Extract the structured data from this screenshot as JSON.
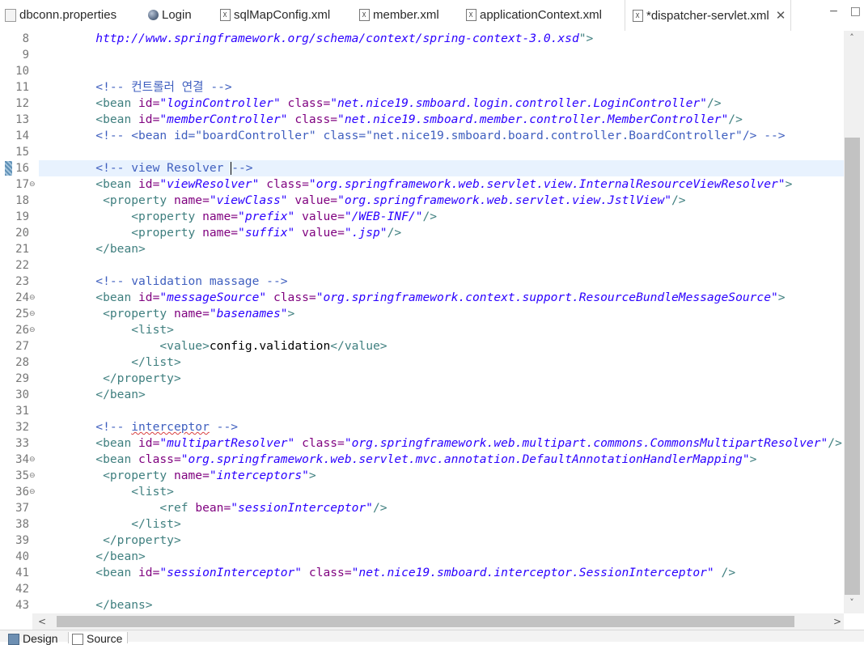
{
  "tabs": [
    {
      "label": "dbconn.properties",
      "icon": "properties-file-icon",
      "active": false,
      "closable": false
    },
    {
      "label": "Login",
      "icon": "globe-icon",
      "active": false,
      "closable": false
    },
    {
      "label": "sqlMapConfig.xml",
      "icon": "xml-file-icon",
      "active": false,
      "closable": false
    },
    {
      "label": "member.xml",
      "icon": "xml-file-icon",
      "active": false,
      "closable": false
    },
    {
      "label": "applicationContext.xml",
      "icon": "xml-file-icon",
      "active": false,
      "closable": false
    },
    {
      "label": "*dispatcher-servlet.xml",
      "icon": "xml-file-icon",
      "active": true,
      "closable": true
    }
  ],
  "tab_close_glyph": "✕",
  "view_controls": {
    "minimize": "−",
    "maximize": "□"
  },
  "editor": {
    "current_line": 16,
    "lines": [
      {
        "n": "8",
        "fold": "",
        "segs": [
          [
            "",
            "        "
          ],
          [
            "v",
            "http://www.springframework.org/schema/context/spring-context-3.0.xsd"
          ],
          [
            "t",
            "\">"
          ]
        ]
      },
      {
        "n": "9",
        "fold": "",
        "segs": []
      },
      {
        "n": "10",
        "fold": "",
        "segs": []
      },
      {
        "n": "11",
        "fold": "",
        "segs": [
          [
            "",
            "        "
          ],
          [
            "c",
            "<!-- 컨트롤러 연결 -->"
          ]
        ]
      },
      {
        "n": "12",
        "fold": "",
        "segs": [
          [
            "",
            "        "
          ],
          [
            "t",
            "<bean "
          ],
          [
            "a",
            "id="
          ],
          [
            "v",
            "\"loginController\""
          ],
          [
            "",
            " "
          ],
          [
            "a",
            "class="
          ],
          [
            "v",
            "\"net.nice19.smboard.login.controller.LoginController\""
          ],
          [
            "t",
            "/>"
          ]
        ]
      },
      {
        "n": "13",
        "fold": "",
        "segs": [
          [
            "",
            "        "
          ],
          [
            "t",
            "<bean "
          ],
          [
            "a",
            "id="
          ],
          [
            "v",
            "\"memberController\""
          ],
          [
            "",
            " "
          ],
          [
            "a",
            "class="
          ],
          [
            "v",
            "\"net.nice19.smboard.member.controller.MemberController\""
          ],
          [
            "t",
            "/>"
          ]
        ]
      },
      {
        "n": "14",
        "fold": "",
        "segs": [
          [
            "",
            "        "
          ],
          [
            "c",
            "<!-- <bean id=\"boardController\" class=\"net.nice19.smboard.board.controller.BoardController\"/> -->"
          ]
        ]
      },
      {
        "n": "15",
        "fold": "",
        "segs": []
      },
      {
        "n": "16",
        "fold": "",
        "segs": [
          [
            "",
            "        "
          ],
          [
            "c",
            "<!-- view Resolver "
          ],
          [
            "caret",
            ""
          ],
          [
            "c",
            "-->"
          ]
        ]
      },
      {
        "n": "17",
        "fold": "⊖",
        "segs": [
          [
            "",
            "        "
          ],
          [
            "t",
            "<bean "
          ],
          [
            "a",
            "id="
          ],
          [
            "v",
            "\"viewResolver\""
          ],
          [
            "",
            " "
          ],
          [
            "a",
            "class="
          ],
          [
            "v",
            "\"org.springframework.web.servlet.view.InternalResourceViewResolver\""
          ],
          [
            "t",
            ">"
          ]
        ]
      },
      {
        "n": "18",
        "fold": "",
        "segs": [
          [
            "",
            "         "
          ],
          [
            "t",
            "<property "
          ],
          [
            "a",
            "name="
          ],
          [
            "v",
            "\"viewClass\""
          ],
          [
            "",
            " "
          ],
          [
            "a",
            "value="
          ],
          [
            "v",
            "\"org.springframework.web.servlet.view.JstlView\""
          ],
          [
            "t",
            "/>"
          ]
        ]
      },
      {
        "n": "19",
        "fold": "",
        "segs": [
          [
            "",
            "             "
          ],
          [
            "t",
            "<property "
          ],
          [
            "a",
            "name="
          ],
          [
            "v",
            "\"prefix\""
          ],
          [
            "",
            " "
          ],
          [
            "a",
            "value="
          ],
          [
            "v",
            "\"/WEB-INF/\""
          ],
          [
            "t",
            "/>"
          ]
        ]
      },
      {
        "n": "20",
        "fold": "",
        "segs": [
          [
            "",
            "             "
          ],
          [
            "t",
            "<property "
          ],
          [
            "a",
            "name="
          ],
          [
            "v",
            "\"suffix\""
          ],
          [
            "",
            " "
          ],
          [
            "a",
            "value="
          ],
          [
            "v",
            "\".jsp\""
          ],
          [
            "t",
            "/>"
          ]
        ]
      },
      {
        "n": "21",
        "fold": "",
        "segs": [
          [
            "",
            "        "
          ],
          [
            "t",
            "</bean>"
          ]
        ]
      },
      {
        "n": "22",
        "fold": "",
        "segs": []
      },
      {
        "n": "23",
        "fold": "",
        "segs": [
          [
            "",
            "        "
          ],
          [
            "c",
            "<!-- validation massage -->"
          ]
        ]
      },
      {
        "n": "24",
        "fold": "⊖",
        "segs": [
          [
            "",
            "        "
          ],
          [
            "t",
            "<bean "
          ],
          [
            "a",
            "id="
          ],
          [
            "v",
            "\"messageSource\""
          ],
          [
            "",
            " "
          ],
          [
            "a",
            "class="
          ],
          [
            "v",
            "\"org.springframework.context.support.ResourceBundleMessageSource\""
          ],
          [
            "t",
            ">"
          ]
        ]
      },
      {
        "n": "25",
        "fold": "⊖",
        "segs": [
          [
            "",
            "         "
          ],
          [
            "t",
            "<property "
          ],
          [
            "a",
            "name="
          ],
          [
            "v",
            "\"basenames\""
          ],
          [
            "t",
            ">"
          ]
        ]
      },
      {
        "n": "26",
        "fold": "⊖",
        "segs": [
          [
            "",
            "             "
          ],
          [
            "t",
            "<list>"
          ]
        ]
      },
      {
        "n": "27",
        "fold": "",
        "segs": [
          [
            "",
            "                 "
          ],
          [
            "t",
            "<value>"
          ],
          [
            "txt",
            "config.validation"
          ],
          [
            "t",
            "</value>"
          ]
        ]
      },
      {
        "n": "28",
        "fold": "",
        "segs": [
          [
            "",
            "             "
          ],
          [
            "t",
            "</list>"
          ]
        ]
      },
      {
        "n": "29",
        "fold": "",
        "segs": [
          [
            "",
            "         "
          ],
          [
            "t",
            "</property>"
          ]
        ]
      },
      {
        "n": "30",
        "fold": "",
        "segs": [
          [
            "",
            "        "
          ],
          [
            "t",
            "</bean>"
          ]
        ]
      },
      {
        "n": "31",
        "fold": "",
        "segs": []
      },
      {
        "n": "32",
        "fold": "",
        "segs": [
          [
            "",
            "        "
          ],
          [
            "c",
            "<!-- "
          ],
          [
            "csq",
            "interceptor"
          ],
          [
            "c",
            " -->"
          ]
        ]
      },
      {
        "n": "33",
        "fold": "",
        "segs": [
          [
            "",
            "        "
          ],
          [
            "t",
            "<bean "
          ],
          [
            "a",
            "id="
          ],
          [
            "v",
            "\"multipartResolver\""
          ],
          [
            "",
            " "
          ],
          [
            "a",
            "class="
          ],
          [
            "v",
            "\"org.springframework.web.multipart.commons.CommonsMultipartResolver\""
          ],
          [
            "t",
            "/>"
          ]
        ]
      },
      {
        "n": "34",
        "fold": "⊖",
        "segs": [
          [
            "",
            "        "
          ],
          [
            "t",
            "<bean "
          ],
          [
            "a",
            "class="
          ],
          [
            "v",
            "\"org.springframework.web.servlet.mvc.annotation.DefaultAnnotationHandlerMapping\""
          ],
          [
            "t",
            ">"
          ]
        ]
      },
      {
        "n": "35",
        "fold": "⊖",
        "segs": [
          [
            "",
            "         "
          ],
          [
            "t",
            "<property "
          ],
          [
            "a",
            "name="
          ],
          [
            "v",
            "\"interceptors\""
          ],
          [
            "t",
            ">"
          ]
        ]
      },
      {
        "n": "36",
        "fold": "⊖",
        "segs": [
          [
            "",
            "             "
          ],
          [
            "t",
            "<list>"
          ]
        ]
      },
      {
        "n": "37",
        "fold": "",
        "segs": [
          [
            "",
            "                 "
          ],
          [
            "t",
            "<ref "
          ],
          [
            "a",
            "bean="
          ],
          [
            "v",
            "\"sessionInterceptor\""
          ],
          [
            "t",
            "/>"
          ]
        ]
      },
      {
        "n": "38",
        "fold": "",
        "segs": [
          [
            "",
            "             "
          ],
          [
            "t",
            "</list>"
          ]
        ]
      },
      {
        "n": "39",
        "fold": "",
        "segs": [
          [
            "",
            "         "
          ],
          [
            "t",
            "</property>"
          ]
        ]
      },
      {
        "n": "40",
        "fold": "",
        "segs": [
          [
            "",
            "        "
          ],
          [
            "t",
            "</bean>"
          ]
        ]
      },
      {
        "n": "41",
        "fold": "",
        "segs": [
          [
            "",
            "        "
          ],
          [
            "t",
            "<bean "
          ],
          [
            "a",
            "id="
          ],
          [
            "v",
            "\"sessionInterceptor\""
          ],
          [
            "",
            " "
          ],
          [
            "a",
            "class="
          ],
          [
            "v",
            "\"net.nice19.smboard.interceptor.SessionInterceptor\""
          ],
          [
            "",
            " "
          ],
          [
            "t",
            "/>"
          ]
        ]
      },
      {
        "n": "42",
        "fold": "",
        "segs": []
      },
      {
        "n": "43",
        "fold": "",
        "segs": [
          [
            "",
            "        "
          ],
          [
            "t",
            "</beans>"
          ]
        ]
      }
    ]
  },
  "scrollbars": {
    "up": "˄",
    "down": "˅",
    "left": "<",
    "right": ">"
  },
  "bottom_tabs": [
    {
      "label": "Design",
      "active": false
    },
    {
      "label": "Source",
      "active": true
    }
  ],
  "colors": {
    "tag": "#3f7f7f",
    "attribute": "#7f007f",
    "value": "#2a00ff",
    "comment": "#3f5fbf",
    "current_line_bg": "#e8f2fe"
  }
}
